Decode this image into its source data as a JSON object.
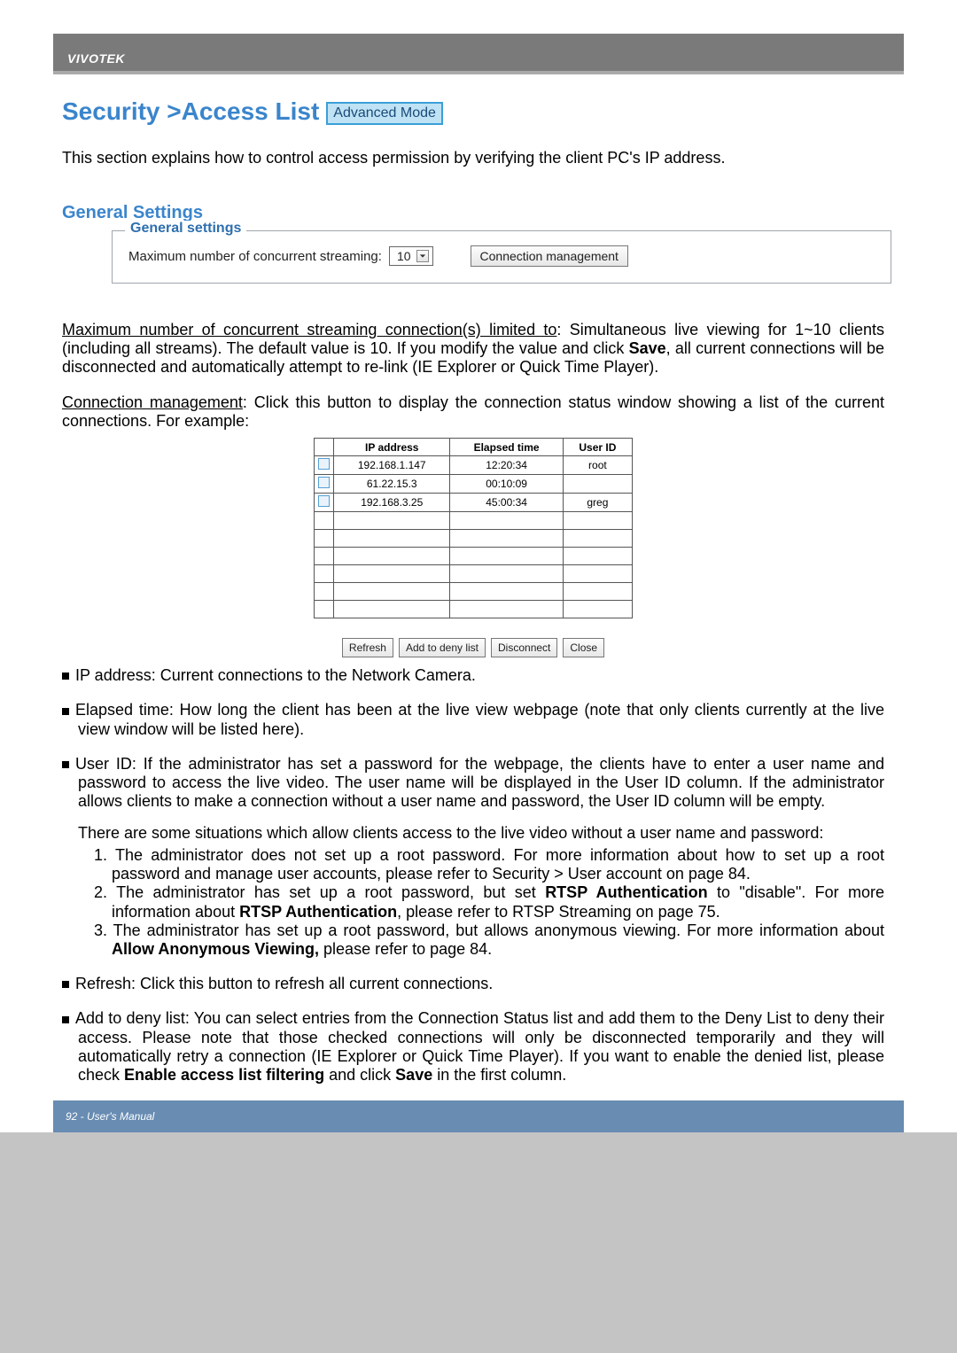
{
  "header": {
    "brand": "VIVOTEK"
  },
  "title": {
    "security": "Security  >",
    "accesslist": "  Access List ",
    "badge": "Advanced Mode"
  },
  "intro": "This section explains how to control access permission by verifying the client PC's IP address.",
  "general": {
    "heading": "General Settings",
    "legend": "General settings",
    "max_label": "Maximum number of concurrent streaming:",
    "max_value": "10",
    "conn_mgmt_btn": "Connection management"
  },
  "p_max": {
    "lead_u": "Maximum number of concurrent streaming connection(s) limited to",
    "rest_a": ": Simultaneous live viewing for 1~10 clients (including all streams). The default value is 10. If you modify the value and click ",
    "save": "Save",
    "rest_b": ", all current connections will be disconnected and automatically attempt to re-link (IE Explorer or Quick Time Player)."
  },
  "p_conn": {
    "lead_u": "Connection management",
    "rest": ": Click this button to display the connection status window showing a list of the current connections. For example:"
  },
  "conn_table": {
    "headers": [
      "IP address",
      "Elapsed time",
      "User ID"
    ],
    "rows": [
      {
        "ip": "192.168.1.147",
        "elapsed": "12:20:34",
        "user": "root",
        "chk": true
      },
      {
        "ip": "61.22.15.3",
        "elapsed": "00:10:09",
        "user": "",
        "chk": true
      },
      {
        "ip": "192.168.3.25",
        "elapsed": "45:00:34",
        "user": "greg",
        "chk": true
      },
      {
        "ip": "",
        "elapsed": "",
        "user": "",
        "chk": false
      },
      {
        "ip": "",
        "elapsed": "",
        "user": "",
        "chk": false
      },
      {
        "ip": "",
        "elapsed": "",
        "user": "",
        "chk": false
      },
      {
        "ip": "",
        "elapsed": "",
        "user": "",
        "chk": false
      },
      {
        "ip": "",
        "elapsed": "",
        "user": "",
        "chk": false
      },
      {
        "ip": "",
        "elapsed": "",
        "user": "",
        "chk": false
      }
    ],
    "buttons": {
      "refresh": "Refresh",
      "add_deny": "Add to deny list",
      "disconnect": "Disconnect",
      "close": "Close"
    }
  },
  "bul_ip": "IP address: Current connections to the Network Camera.",
  "bul_elapsed": "Elapsed time: How long the client has been at the live view webpage (note that only clients currently at the live view window will be listed here).",
  "bul_user": "User ID: If the administrator has set a password for the webpage, the clients have to enter a user name and password to access the live video. The user name will be displayed in the User ID column. If  the administrator allows clients to make a connection without a user name and password, the User ID column will be empty.",
  "cont_situations": "There are some situations which allow clients access to the live video without a user name and password:",
  "numitems": {
    "n1": "1. The administrator does not set up a root password. For more information about how to set up a root password and manage user accounts, please refer to Security > User account on page 84.",
    "n2a": "2. The administrator has set up a root password, but set ",
    "n2_bold1": "RTSP Authentication",
    "n2b": " to \"disable\". For more information about ",
    "n2_bold2": "RTSP Authentication",
    "n2c": ", please refer to RTSP Streaming on page 75.",
    "n3a": "3. The administrator has set up a root password, but allows anonymous viewing. For more information about ",
    "n3_bold": "Allow Anonymous Viewing,",
    "n3b": " please refer to page 84."
  },
  "bul_refresh": "Refresh: Click this button to refresh all current connections.",
  "bul_add": {
    "a": "Add to deny list: You can select entries from the Connection Status list and add them to the Deny List to deny their access. Please note that those checked connections will only be disconnected temporarily and they will automatically retry a connection (IE Explorer or Quick Time Player). If you want to enable the denied list, please check ",
    "bold": "Enable access list filtering",
    "b": " and click ",
    "save": "Save",
    "c": " in the first column."
  },
  "footer": "92 - User's Manual"
}
